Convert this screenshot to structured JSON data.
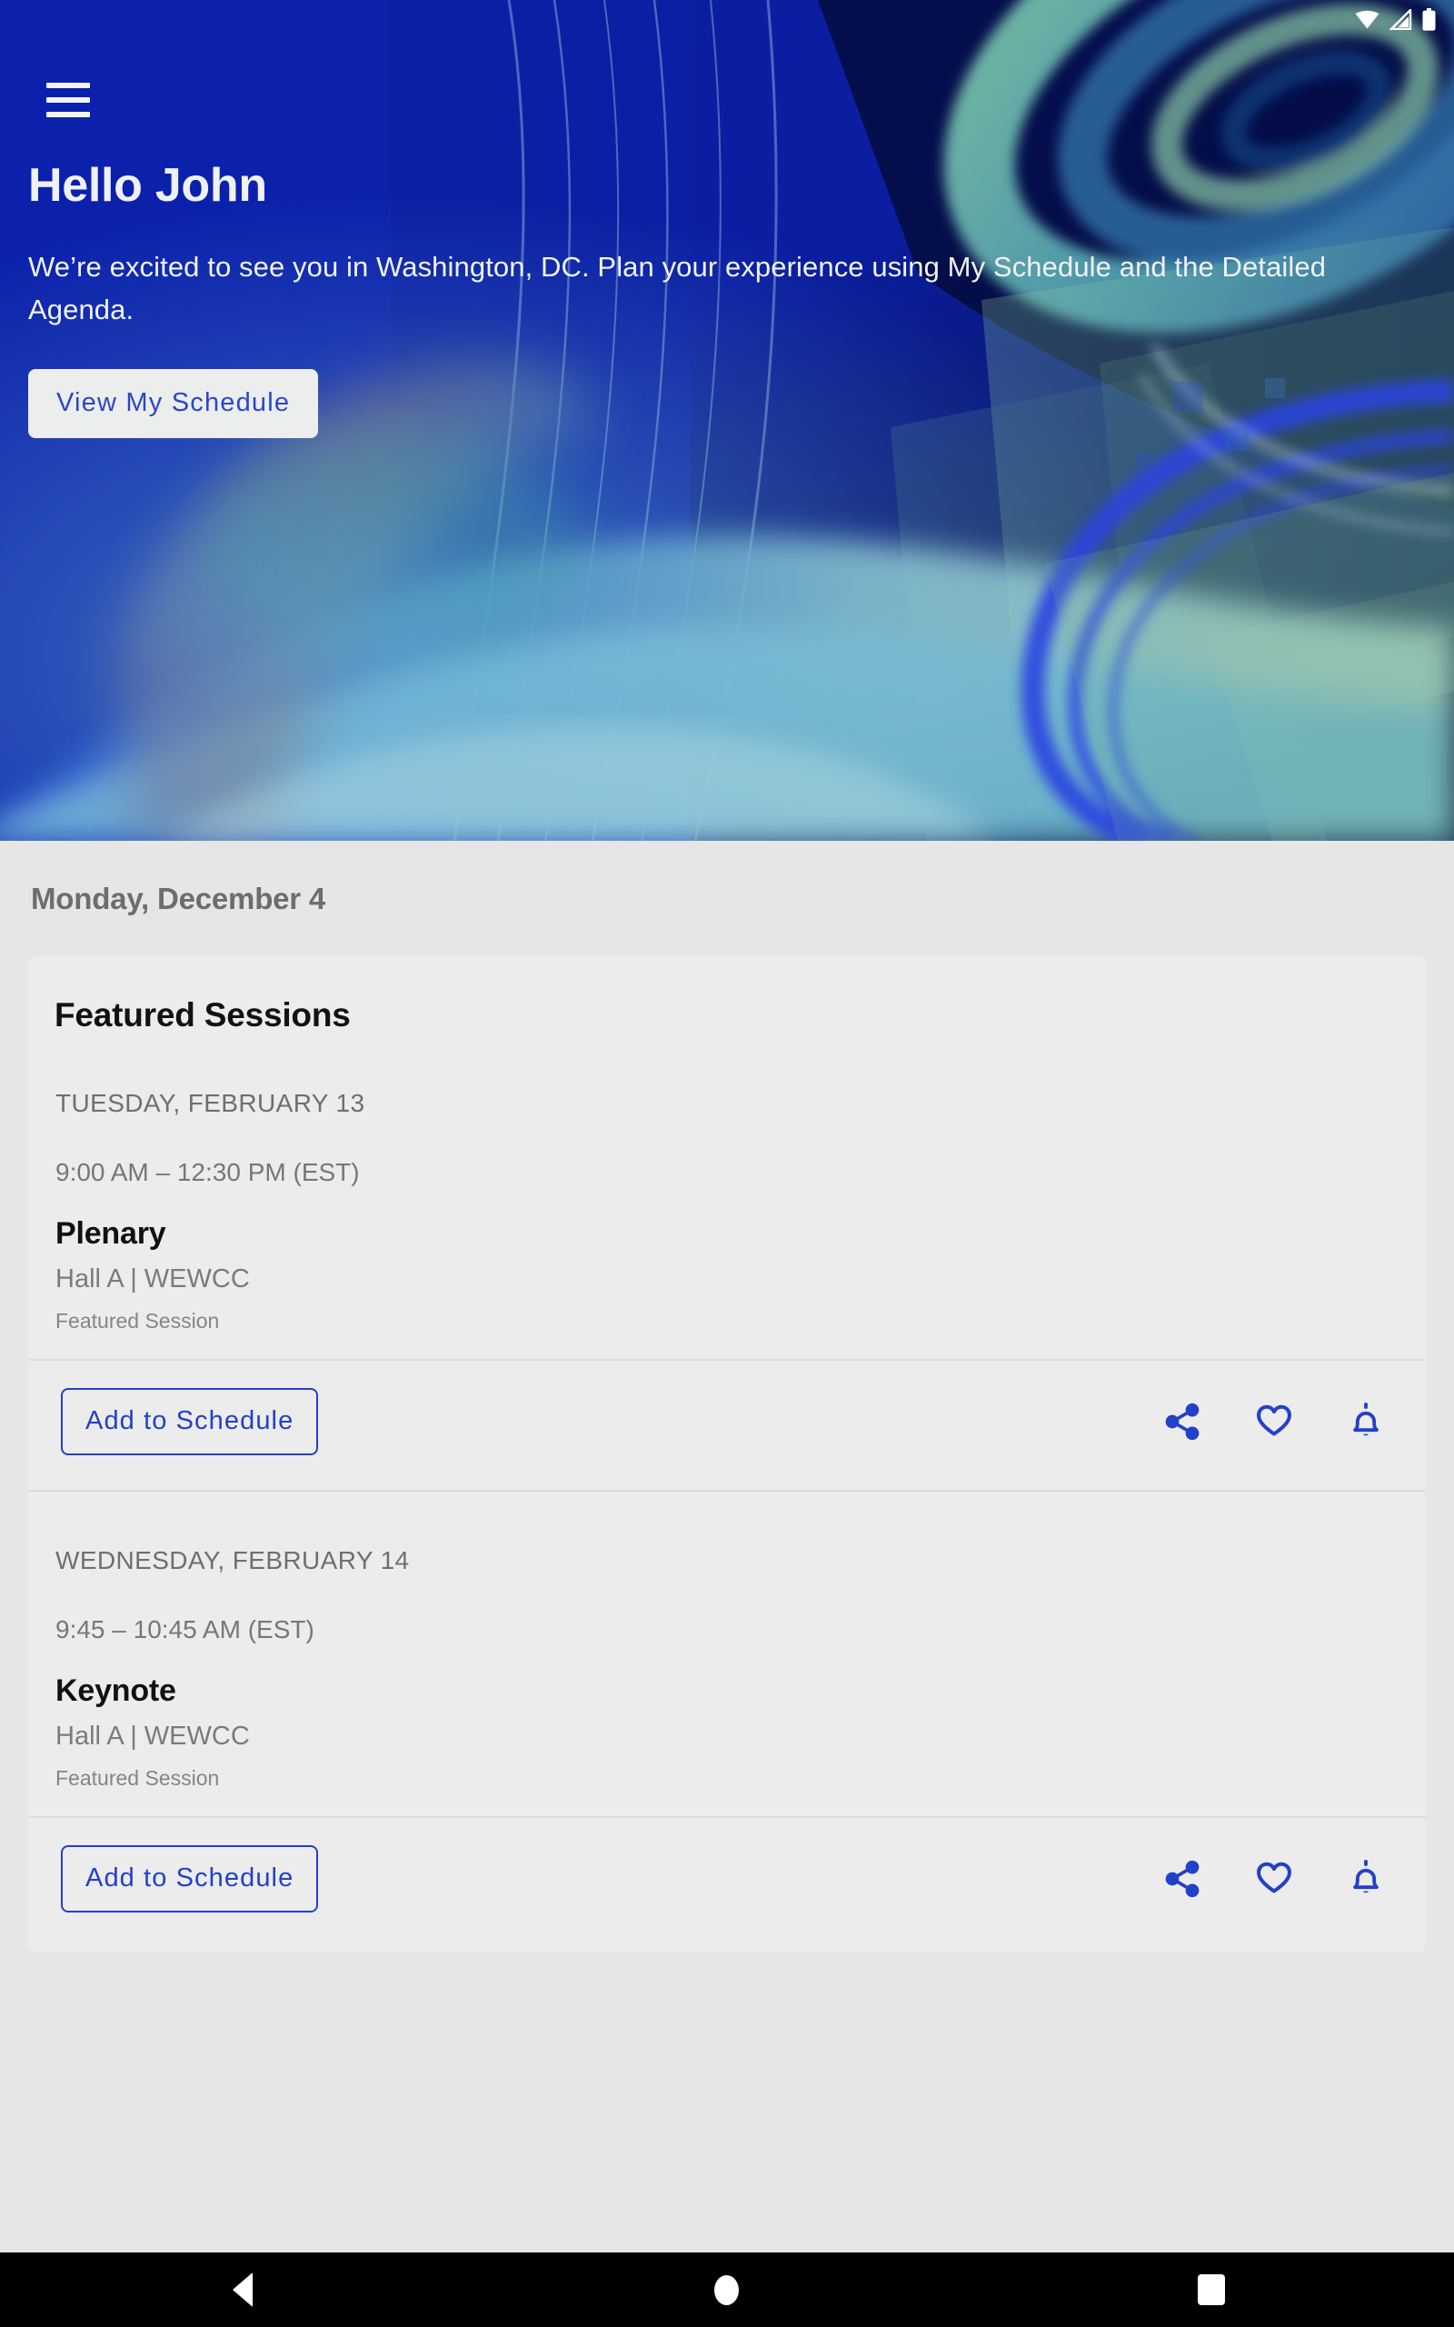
{
  "status_bar": {
    "wifi_icon": "wifi-icon",
    "signal_icon": "cellular-signal-icon",
    "battery_icon": "battery-icon"
  },
  "hero": {
    "menu_icon": "hamburger-menu-icon",
    "title": "Hello John",
    "subtitle": "We’re excited to see you in Washington, DC. Plan your experience using My Schedule and the Detailed Agenda.",
    "cta_label": "View My Schedule",
    "background_color": "#081a9b",
    "cta_bg_color": "#eceded",
    "cta_text_color": "#2b47c9"
  },
  "content": {
    "date_header": "Monday, December 4",
    "card": {
      "title": "Featured Sessions",
      "sessions": [
        {
          "day_label": "TUESDAY, FEBRUARY 13",
          "time": "9:00 AM – 12:30 PM (EST)",
          "name": "Plenary",
          "location": "Hall A | WEWCC",
          "tag": "Featured Session",
          "add_label": "Add to Schedule",
          "actions": {
            "share_icon": "share-icon",
            "favorite_icon": "heart-icon",
            "reminder_icon": "bell-icon"
          }
        },
        {
          "day_label": "WEDNESDAY, FEBRUARY 14",
          "time": "9:45 – 10:45 AM (EST)",
          "name": "Keynote",
          "location": "Hall A | WEWCC",
          "tag": "Featured Session",
          "add_label": "Add to Schedule",
          "actions": {
            "share_icon": "share-icon",
            "favorite_icon": "heart-icon",
            "reminder_icon": "bell-icon"
          }
        }
      ]
    }
  },
  "navbar": {
    "back_icon": "back-triangle-icon",
    "home_icon": "home-circle-icon",
    "recents_icon": "recents-square-icon"
  },
  "colors": {
    "accent_blue": "#2340c8",
    "page_background": "#e6e6e6",
    "card_background": "#ececec",
    "hero_blue": "#081a9b"
  }
}
